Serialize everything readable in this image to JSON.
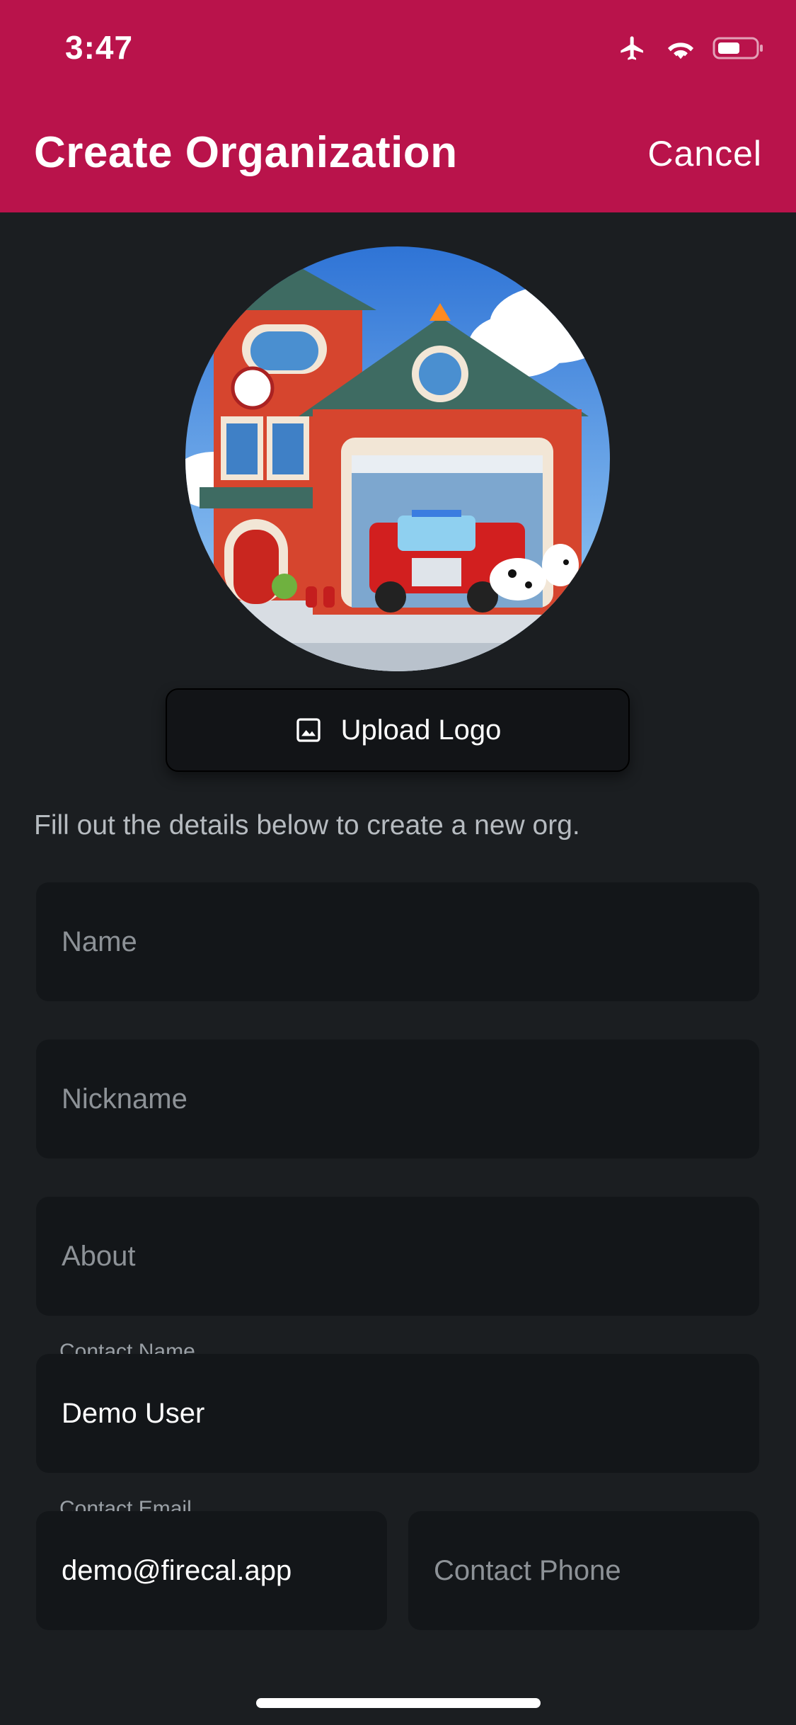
{
  "status_bar": {
    "time": "3:47"
  },
  "header": {
    "title": "Create Organization",
    "cancel_label": "Cancel"
  },
  "upload": {
    "label": "Upload Logo",
    "icon": "image-icon"
  },
  "helper_text": "Fill out the details below to create a new org.",
  "form": {
    "name": {
      "placeholder": "Name",
      "value": ""
    },
    "nickname": {
      "placeholder": "Nickname",
      "value": ""
    },
    "about": {
      "placeholder": "About",
      "value": ""
    },
    "contact_name": {
      "label": "Contact Name",
      "value": "Demo User"
    },
    "contact_email": {
      "label": "Contact Email",
      "value": "demo@firecal.app"
    },
    "contact_phone": {
      "placeholder": "Contact Phone",
      "value": ""
    }
  },
  "colors": {
    "accent": "#b9134b",
    "background": "#1b1e21",
    "field": "#131619"
  }
}
